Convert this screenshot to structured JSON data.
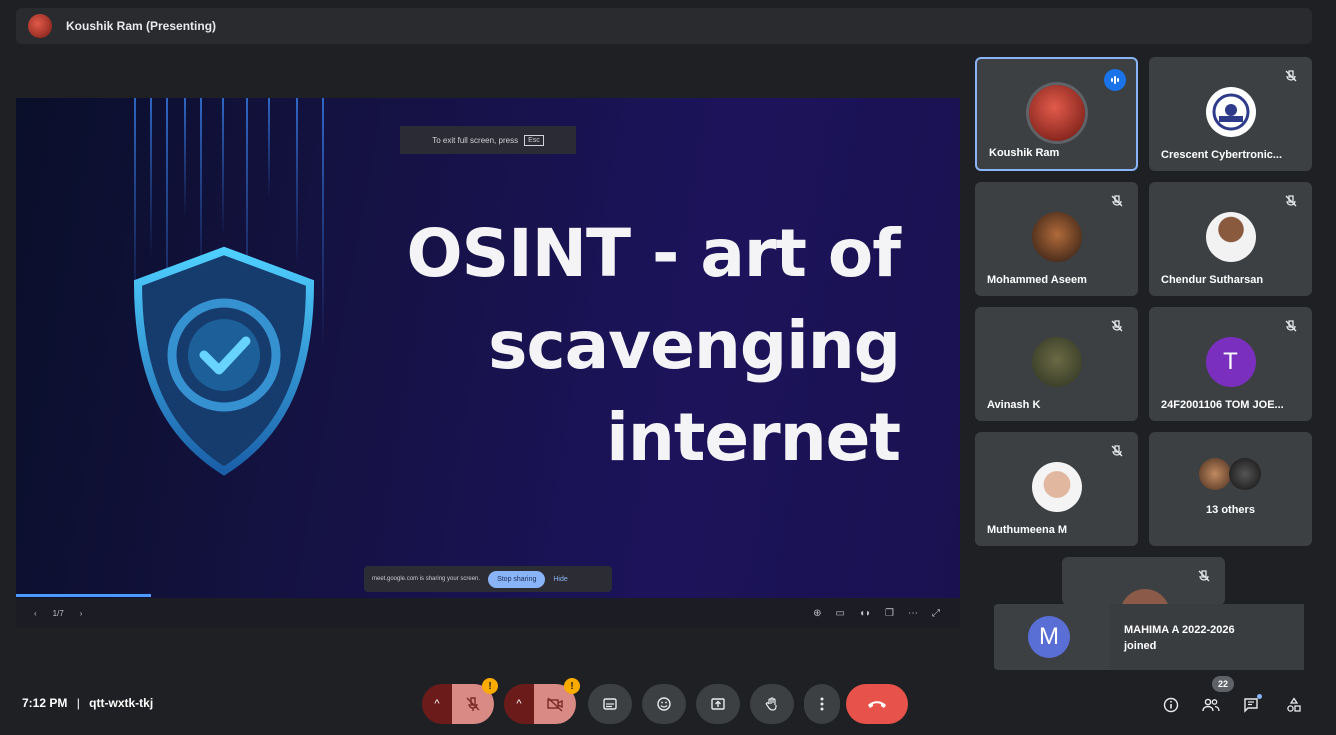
{
  "presenter_bar": {
    "title": "Koushik Ram (Presenting)"
  },
  "slide": {
    "exit_hint": "To exit full screen, press",
    "exit_key": "Esc",
    "headline": [
      "OSINT - art of",
      "scavenging",
      "internet"
    ],
    "share_notice": "meet.google.com is sharing your screen.",
    "stop_sharing": "Stop sharing",
    "hide": "Hide",
    "page_indicator": "1/7"
  },
  "participants": [
    {
      "name": "Koushik Ram",
      "speaking": true
    },
    {
      "name": "Crescent Cybertronic...",
      "muted": true
    },
    {
      "name": "Mohammed Aseem",
      "muted": true
    },
    {
      "name": "Chendur Sutharsan",
      "muted": true
    },
    {
      "name": "Avinash K",
      "muted": true
    },
    {
      "name": "24F2001106 TOM JOE...",
      "muted": true,
      "initial": "T",
      "color": "#7b2fbe"
    },
    {
      "name": "Muthumeena M",
      "muted": true
    },
    {
      "name": "13 others"
    }
  ],
  "toast": {
    "initial": "M",
    "line1": "MAHIMA A 2022-2026",
    "line2": "joined"
  },
  "footer": {
    "time": "7:12 PM",
    "separator": "|",
    "meeting_code": "qtt-wxtk-tkj",
    "warning": "!",
    "people_count": "22"
  },
  "colors": {
    "accent": "#8ab4f8",
    "end_call": "#e7524a",
    "mic_off": "#d98a84"
  }
}
